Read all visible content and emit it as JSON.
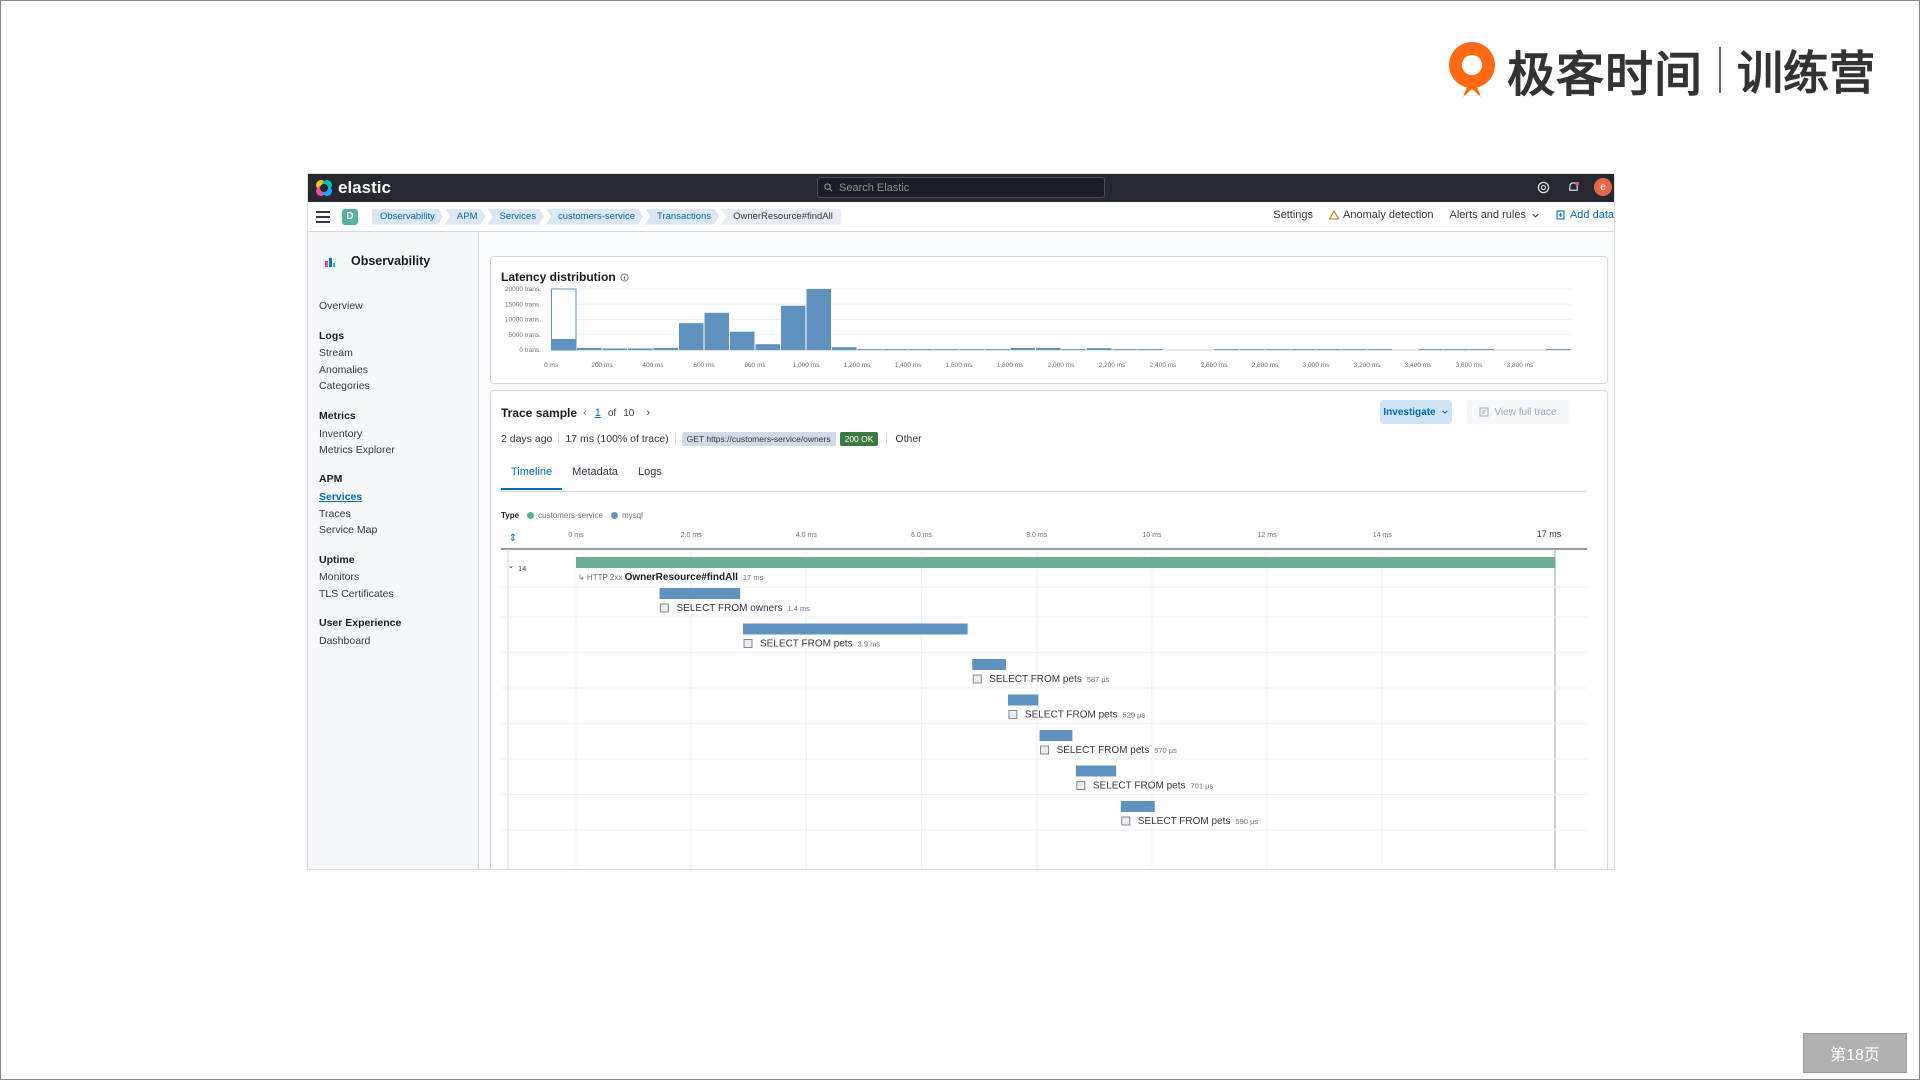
{
  "brand": {
    "name": "极客时间",
    "sub": "训练营"
  },
  "page_badge": "第18页",
  "topbar": {
    "logo": "elastic",
    "search_placeholder": "Search Elastic"
  },
  "navbar": {
    "space": "D",
    "breadcrumbs": [
      "Observability",
      "APM",
      "Services",
      "customers-service",
      "Transactions",
      "OwnerResource#findAll"
    ],
    "settings": "Settings",
    "anomaly": "Anomaly detection",
    "alerts": "Alerts and rules",
    "add_data": "Add data"
  },
  "sidebar": {
    "title": "Observability",
    "overview": "Overview",
    "logs": {
      "head": "Logs",
      "items": [
        "Stream",
        "Anomalies",
        "Categories"
      ]
    },
    "metrics": {
      "head": "Metrics",
      "items": [
        "Inventory",
        "Metrics Explorer"
      ]
    },
    "apm": {
      "head": "APM",
      "items": [
        "Services",
        "Traces",
        "Service Map"
      ]
    },
    "uptime": {
      "head": "Uptime",
      "items": [
        "Monitors",
        "TLS Certificates"
      ]
    },
    "ux": {
      "head": "User Experience",
      "items": [
        "Dashboard"
      ]
    }
  },
  "latency": {
    "title": "Latency distribution",
    "chart_data": {
      "type": "bar",
      "title": "Latency distribution",
      "y_ticks": [
        "20000 trans.",
        "15000 trans.",
        "10000 trans.",
        "5000 trans.",
        "0 trans."
      ],
      "x_ticks": [
        "0 ms",
        "200 ms",
        "400 ms",
        "600 ms",
        "800 ms",
        "1,000 ms",
        "1,200 ms",
        "1,400 ms",
        "1,600 ms",
        "1,800 ms",
        "2,000 ms",
        "2,200 ms",
        "2,400 ms",
        "2,600 ms",
        "2,800 ms",
        "3,000 ms",
        "3,200 ms",
        "3,400 ms",
        "3,600 ms",
        "3,800 ms"
      ],
      "ylim": [
        0,
        20000
      ],
      "values": [
        3600,
        700,
        500,
        500,
        700,
        8800,
        12200,
        6000,
        1900,
        14500,
        20000,
        900,
        300,
        300,
        300,
        300,
        300,
        300,
        700,
        700,
        300,
        600,
        300,
        300,
        0,
        0,
        300,
        300,
        300,
        300,
        300,
        300,
        300,
        0,
        300,
        300,
        300,
        0,
        0,
        300
      ],
      "selected_bucket": 0
    }
  },
  "trace": {
    "title": "Trace sample",
    "page": "1",
    "of": "of",
    "total": "10",
    "investigate": "Investigate",
    "view_full": "View full trace",
    "age": "2 days ago",
    "duration": "17 ms (100% of trace)",
    "request": "GET https://customers-service/owners",
    "status": "200 OK",
    "other": "Other",
    "tabs": [
      "Timeline",
      "Metadata",
      "Logs"
    ],
    "type_label": "Type",
    "legend": [
      {
        "name": "customers-service",
        "color": "#54b399"
      },
      {
        "name": "mysql",
        "color": "#6092c0"
      }
    ],
    "axis": [
      "0 ms",
      "2.0 ms",
      "4.0 ms",
      "6.0 ms",
      "8.0 ms",
      "10 ms",
      "12 ms",
      "14 ms"
    ],
    "axis_end": "17 ms",
    "root": {
      "count": "14",
      "kind": "HTTP 2xx",
      "name": "OwnerResource#findAll",
      "dur": "17 ms",
      "start": 0,
      "length": 17
    },
    "spans": [
      {
        "name": "SELECT FROM owners",
        "dur": "1.4 ms",
        "start": 1.45,
        "length": 1.4
      },
      {
        "name": "SELECT FROM pets",
        "dur": "3.9 ms",
        "start": 2.9,
        "length": 3.9
      },
      {
        "name": "SELECT FROM pets",
        "dur": "587 μs",
        "start": 6.88,
        "length": 0.587
      },
      {
        "name": "SELECT FROM pets",
        "dur": "529 μs",
        "start": 7.5,
        "length": 0.529
      },
      {
        "name": "SELECT FROM pets",
        "dur": "570 μs",
        "start": 8.05,
        "length": 0.57
      },
      {
        "name": "SELECT FROM pets",
        "dur": "701 μs",
        "start": 8.68,
        "length": 0.701
      },
      {
        "name": "SELECT FROM pets",
        "dur": "590 μs",
        "start": 9.46,
        "length": 0.59
      }
    ]
  }
}
